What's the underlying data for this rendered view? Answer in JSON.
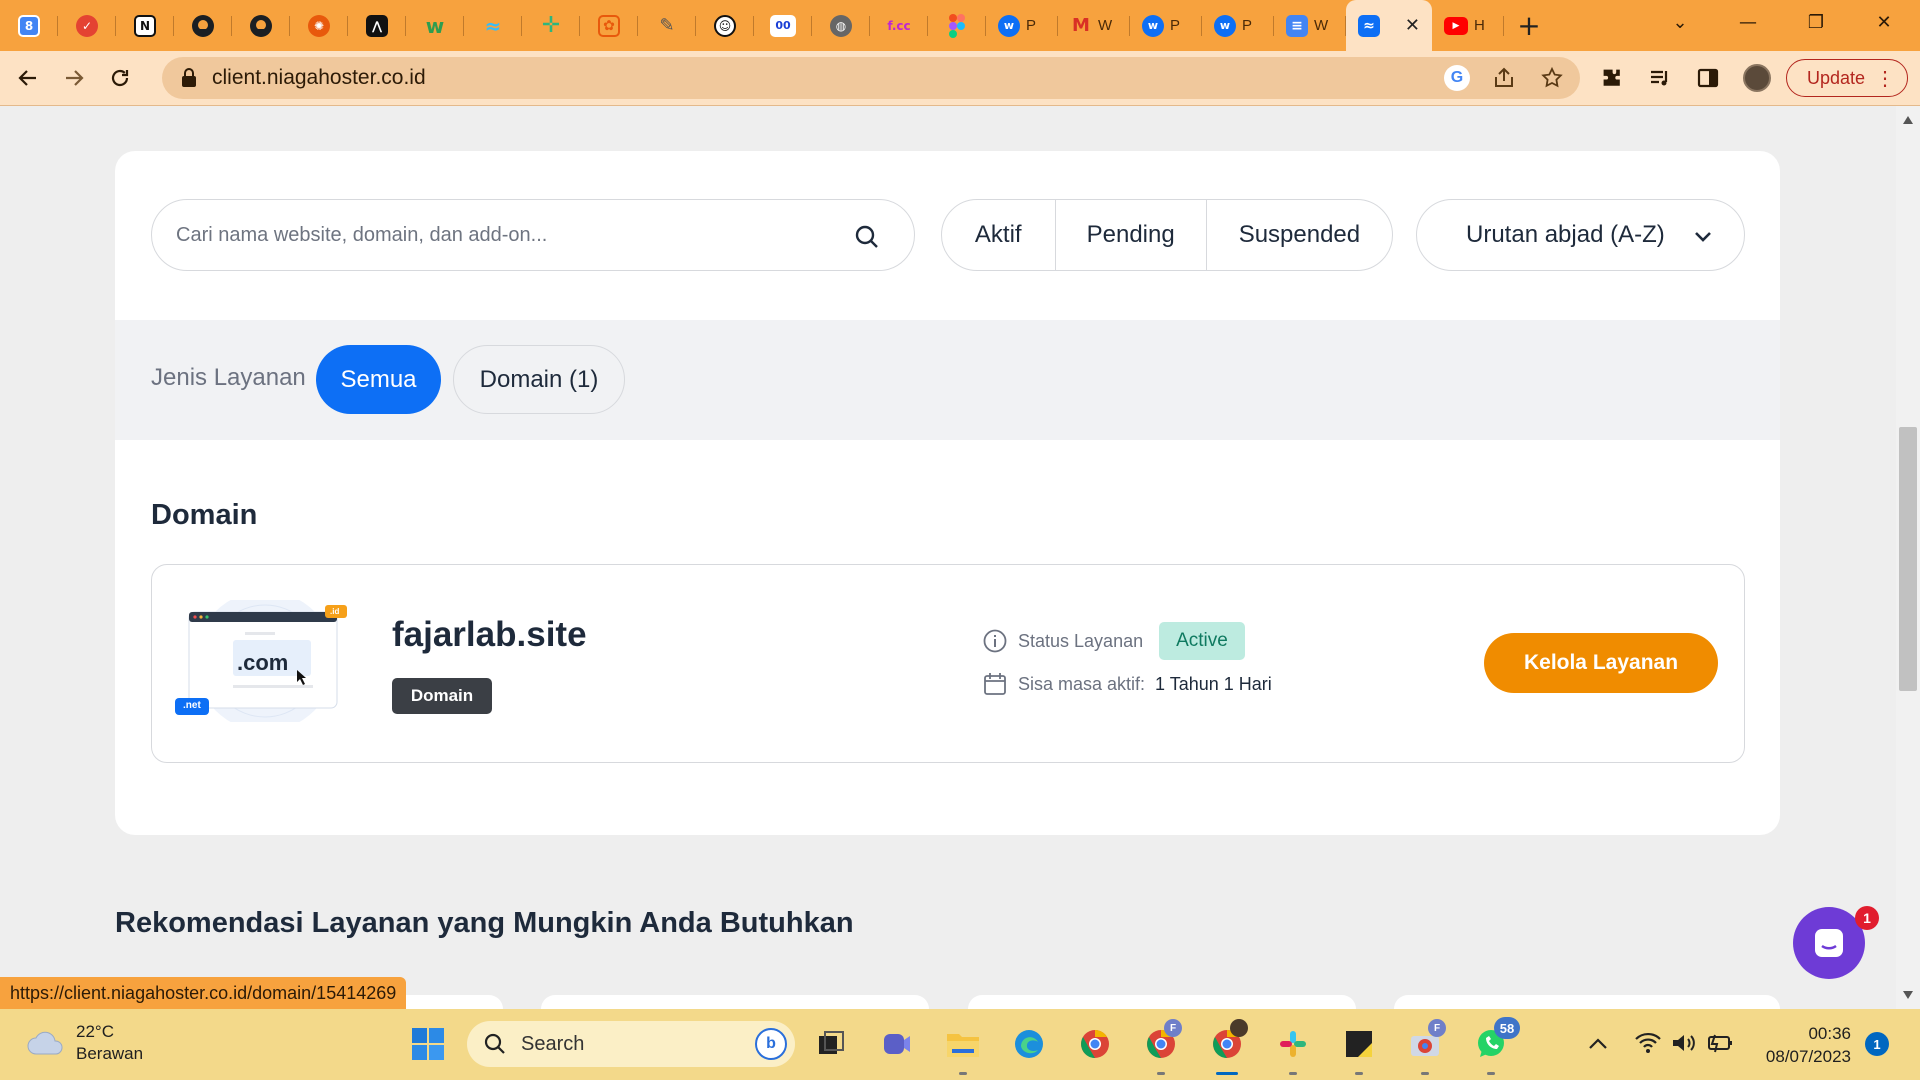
{
  "browser": {
    "tabs": [
      {
        "icon": "google-calendar-icon",
        "label": "8",
        "color": "#4285f4"
      },
      {
        "icon": "todoist-icon",
        "color": "#e44332"
      },
      {
        "icon": "notion-icon",
        "label": "N",
        "color": "#111111"
      },
      {
        "icon": "github-icon",
        "color": "#1b1f23"
      },
      {
        "icon": "github-icon",
        "color": "#1b1f23"
      },
      {
        "icon": "asterisk-app-icon",
        "color": "#e8590c"
      },
      {
        "icon": "codepen-icon",
        "color": "#111111"
      },
      {
        "icon": "webflow-w-icon",
        "label": "w",
        "color": "#2e9d4f"
      },
      {
        "icon": "tailwind-icon",
        "color": "#38bdf8"
      },
      {
        "icon": "slack-plus-icon",
        "color": "#2eb67d"
      },
      {
        "icon": "chatgpt-icon",
        "color": "#e8590c"
      },
      {
        "icon": "feather-icon",
        "color": "#555555"
      },
      {
        "icon": "grammarly-icon",
        "color": "#111111"
      },
      {
        "icon": "infinity-icon",
        "label": "00",
        "color": "#1a3fd6"
      },
      {
        "icon": "globe-icon",
        "color": "#555555"
      },
      {
        "icon": "freecodecamp-icon",
        "label": "f.cc",
        "color": "#c026d3"
      },
      {
        "icon": "figma-icon",
        "color": "#a259ff"
      },
      {
        "icon": "webflow-icon",
        "label": "P",
        "color": "#0d6ff5"
      },
      {
        "icon": "gmail-icon",
        "label": "W",
        "color": "#d93025"
      },
      {
        "icon": "webflow-icon",
        "label": "P",
        "color": "#0d6ff5"
      },
      {
        "icon": "webflow-icon",
        "label": "P",
        "color": "#0d6ff5"
      },
      {
        "icon": "google-docs-icon",
        "label": "W",
        "color": "#4285f4"
      },
      {
        "icon": "niagahoster-icon",
        "color": "#0d6ff5",
        "active": true
      },
      {
        "icon": "youtube-icon",
        "label": "H",
        "color": "#ff0000"
      }
    ],
    "address": "client.niagahoster.co.id",
    "update_label": "Update",
    "status_url": "https://client.niagahoster.co.id/domain/15414269"
  },
  "filters": {
    "search_placeholder": "Cari nama website, domain, dan add-on...",
    "status_tabs": [
      "Aktif",
      "Pending",
      "Suspended"
    ],
    "sort_label": "Urutan abjad (A-Z)"
  },
  "service_types": {
    "label": "Jenis Layanan",
    "all_label": "Semua",
    "domain_label": "Domain (1)"
  },
  "domain_section": {
    "title": "Domain",
    "item": {
      "thumb_com": ".com",
      "thumb_net": ".net",
      "thumb_id": ".id",
      "name": "fajarlab.site",
      "badge": "Domain",
      "status_label": "Status Layanan",
      "status_value": "Active",
      "remaining_label": "Sisa masa aktif:",
      "remaining_value": "1 Tahun 1 Hari",
      "manage_label": "Kelola Layanan"
    }
  },
  "recommendations": {
    "title": "Rekomendasi Layanan yang Mungkin Anda Butuhkan"
  },
  "chat": {
    "badge": "1"
  },
  "taskbar": {
    "weather_temp": "22°C",
    "weather_desc": "Berawan",
    "search_label": "Search",
    "whatsapp_badge": "58",
    "time": "00:36",
    "date": "08/07/2023",
    "notification_count": "1"
  },
  "colors": {
    "accent": "#0d6ff5",
    "manage": "#f08c00",
    "status_bg": "#bdebe0",
    "tabbar": "#f7a23e"
  }
}
